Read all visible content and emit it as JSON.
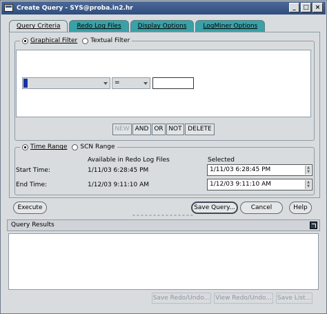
{
  "window": {
    "title": "Create Query - SYS@proba.in2.hr",
    "min": "_",
    "max": "□",
    "close": "×"
  },
  "tabs": [
    {
      "label": "Query Criteria",
      "active": true
    },
    {
      "label": "Redo Log Files",
      "active": false
    },
    {
      "label": "Display Options",
      "active": false
    },
    {
      "label": "LogMiner Options",
      "active": false
    }
  ],
  "filter": {
    "graphical_label": "Graphical Filter",
    "textual_label": "Textual Filter",
    "selected": "graphical",
    "column_combo": "",
    "operator": "=",
    "value": ""
  },
  "filter_buttons": {
    "new": "NEW",
    "and": "AND",
    "or": "OR",
    "not": "NOT",
    "delete": "DELETE"
  },
  "range": {
    "time_label": "Time Range",
    "scn_label": "SCN Range",
    "selected": "time",
    "available_header": "Available in Redo Log Files",
    "selected_header": "Selected",
    "start_label": "Start Time:",
    "end_label": "End Time:",
    "start_available": "1/11/03 6:28:45 PM",
    "end_available": "1/12/03 9:11:10 AM",
    "start_selected": "1/11/03 6:28:45 PM",
    "end_selected": "1/12/03 9:11:10 AM"
  },
  "actions": {
    "execute": "Execute",
    "save_query": "Save Query...",
    "cancel": "Cancel",
    "help": "Help"
  },
  "results": {
    "header": "Query Results",
    "save_redo_undo": "Save Redo/Undo...",
    "view_redo_undo": "View Redo/Undo...",
    "save_list": "Save List..."
  },
  "colors": {
    "tab_active_bg": "#d9dcde",
    "tab_inactive_bg": "#3aa1a8",
    "title_bar": "#2f4d7d"
  }
}
